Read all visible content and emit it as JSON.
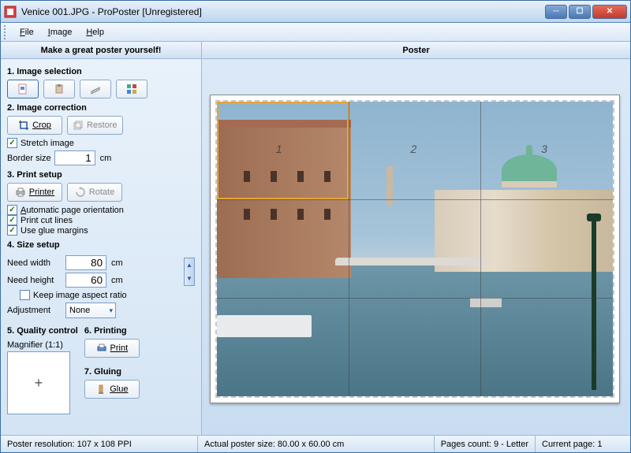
{
  "window": {
    "title": "Venice 001.JPG - ProPoster [Unregistered]"
  },
  "menu": {
    "file": "File",
    "image": "Image",
    "help": "Help"
  },
  "toolstrip": {
    "left": "Make a great poster yourself!",
    "right": "Poster"
  },
  "sidebar": {
    "sec1_title": "1. Image selection",
    "sec2_title": "2. Image correction",
    "crop_label": "Crop",
    "restore_label": "Restore",
    "stretch_label": "Stretch image",
    "border_label": "Border size",
    "border_value": "1",
    "border_unit": "cm",
    "sec3_title": "3. Print setup",
    "printer_label": "Printer",
    "rotate_label": "Rotate",
    "auto_orient": "Automatic page orientation",
    "cut_lines": "Print cut lines",
    "glue_margins": "Use glue margins",
    "sec4_title": "4. Size setup",
    "need_width_label": "Need width",
    "need_width_value": "80",
    "need_width_unit": "cm",
    "need_height_label": "Need height",
    "need_height_value": "60",
    "need_height_unit": "cm",
    "keep_aspect": "Keep image aspect ratio",
    "adjustment_label": "Adjustment",
    "adjustment_value": "None",
    "sec5_title": "5. Quality control",
    "magnifier_label": "Magnifier (1:1)",
    "sec6_title": "6. Printing",
    "print_label": "Print",
    "sec7_title": "7. Gluing",
    "glue_label": "Glue"
  },
  "grid": {
    "n1": "1",
    "n2": "2",
    "n3": "3"
  },
  "status": {
    "resolution": "Poster resolution: 107 x 108 PPI",
    "actual_size": "Actual poster size: 80.00 x 60.00 cm",
    "pages_count": "Pages count: 9 - Letter",
    "current_page": "Current page: 1"
  }
}
